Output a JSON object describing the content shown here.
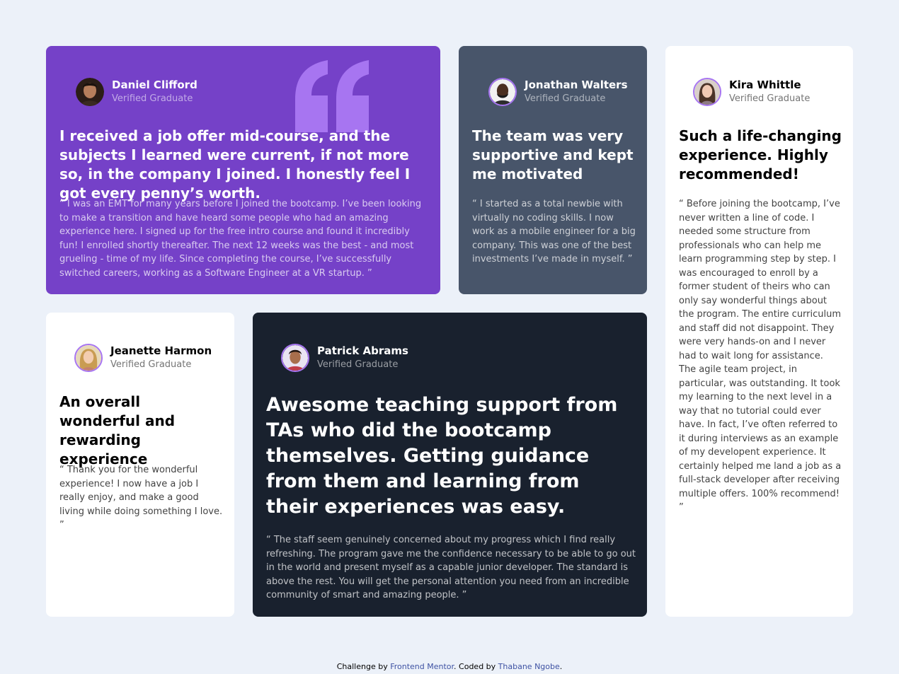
{
  "footer": {
    "prefix": "Challenge by",
    "link1": "Frontend Mentor",
    "middle": ". Coded by",
    "link2": "Thabane Ngobe",
    "suffix": "."
  },
  "colors": {
    "purple": "#7541c8",
    "slate": "#48556a",
    "dark": "#19212e",
    "white": "#ffffff",
    "background": "#ecf1f9",
    "accent": "#a775f1"
  },
  "testimonials": [
    {
      "name": "Daniel Clifford",
      "role": "Verified Graduate",
      "headline": "I received a job offer mid-course, and the subjects I learned were current, if not more so, in the company I joined. I honestly feel I got every penny’s worth.",
      "quote": "“ I was an EMT for many years before I joined the bootcamp. I’ve been looking to make a transition and have heard some people who had an amazing experience here. I signed up for the free intro course and found it incredibly fun! I enrolled shortly thereafter. The next 12 weeks was the best - and most grueling - time of my life. Since completing the course, I’ve successfully switched careers, working as a Software Engineer at a VR startup. ”",
      "theme": "purple",
      "avatar_icon": "avatar-daniel"
    },
    {
      "name": "Jonathan Walters",
      "role": "Verified Graduate",
      "headline": "The team was very supportive and kept me motivated",
      "quote": "“ I started as a total newbie with virtually no coding skills. I now work as a mobile engineer for a big company. This was one of the best investments I’ve made in myself. ”",
      "theme": "slate",
      "avatar_icon": "avatar-jonathan"
    },
    {
      "name": "Kira Whittle",
      "role": "Verified Graduate",
      "headline": "Such a life-changing experience. Highly recommended!",
      "quote": "“ Before joining the bootcamp, I’ve never written a line of code. I needed some structure from professionals who can help me learn programming step by step. I was encouraged to enroll by a former student of theirs who can only say wonderful things about the program. The entire curriculum and staff did not disappoint. They were very hands-on and I never had to wait long for assistance. The agile team project, in particular, was outstanding. It took my learning to the next level in a way that no tutorial could ever have. In fact, I’ve often referred to it during interviews as an example of my developent experience. It certainly helped me land a job as a full-stack developer after receiving multiple offers. 100% recommend! ”",
      "theme": "white",
      "avatar_icon": "avatar-kira"
    },
    {
      "name": "Jeanette Harmon",
      "role": "Verified Graduate",
      "headline": "An overall wonderful and rewarding experience",
      "quote": "“ Thank you for the wonderful experience! I now have a job I really enjoy, and make a good living while doing something I love. ”",
      "theme": "white",
      "avatar_icon": "avatar-jeanette"
    },
    {
      "name": "Patrick Abrams",
      "role": "Verified Graduate",
      "headline": "Awesome teaching support from TAs who did the bootcamp themselves. Getting guidance from them and learning from their experiences was easy.",
      "quote": "“ The staff seem genuinely concerned about my progress which I find really refreshing. The program gave me the confidence necessary to be able to go out in the world and present myself as a capable junior developer. The standard is above the rest. You will get the personal attention you need from an incredible community of smart and amazing people. ”",
      "theme": "dark",
      "avatar_icon": "avatar-patrick"
    }
  ]
}
